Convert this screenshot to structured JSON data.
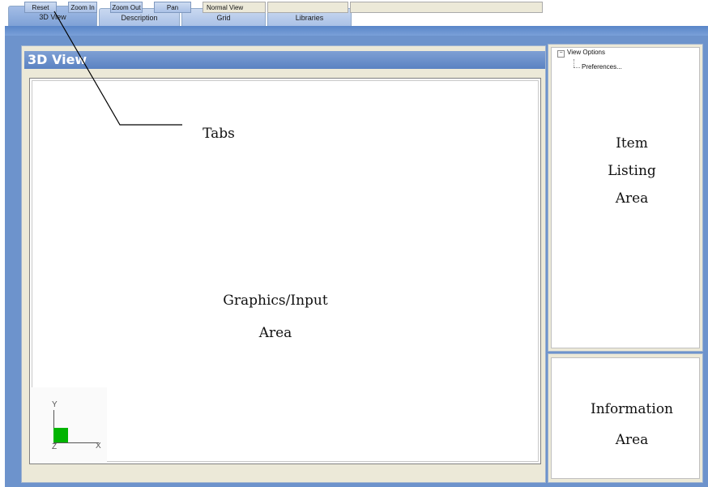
{
  "tabs": [
    {
      "label": "3D View",
      "active": true
    },
    {
      "label": "Description",
      "active": false
    },
    {
      "label": "Grid",
      "active": false
    },
    {
      "label": "Libraries",
      "active": false
    }
  ],
  "panel_title": "3D View",
  "tree": {
    "root": "View Options",
    "child": "Preferences..."
  },
  "axis": {
    "y": "Y",
    "x": "X",
    "z": "Z"
  },
  "toolbar": {
    "buttons": [
      "Reset",
      "Zoom In",
      "Zoom Out",
      "Pan"
    ],
    "status": "Normal View"
  },
  "annotations": {
    "tabs": "Tabs",
    "graphics_line1": "Graphics/Input",
    "graphics_line2": "Area",
    "item_line1": "Item",
    "item_line2": "Listing",
    "item_line3": "Area",
    "info_line1": "Information",
    "info_line2": "Area"
  },
  "colors": {
    "frame": "#6d93cc",
    "axis_square": "#00b400"
  }
}
